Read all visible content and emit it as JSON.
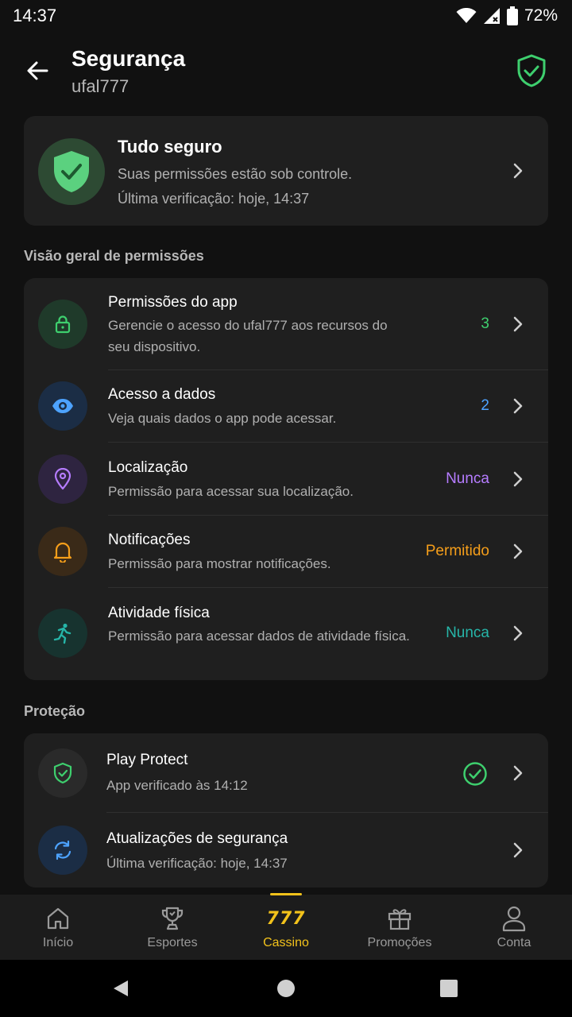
{
  "status_bar": {
    "time": "14:37",
    "battery": "72%"
  },
  "header": {
    "title": "Segurança",
    "subtitle": "ufal777"
  },
  "hero": {
    "title": "Tudo seguro",
    "line1": "Suas permissões estão sob controle.",
    "line2": "Última verificação: hoje, 14:37"
  },
  "permissions_section": {
    "label": "Visão geral de permissões",
    "items": [
      {
        "title": "Permissões do app",
        "desc": "Gerencie o acesso do ufal777 aos recursos do seu dispositivo.",
        "value": "3",
        "value_color": "#3ecf6e",
        "icon": "lock-icon"
      },
      {
        "title": "Acesso a dados",
        "desc": "Veja quais dados o app pode acessar.",
        "value": "2",
        "value_color": "#4da3ff",
        "icon": "eye-icon"
      },
      {
        "title": "Localização",
        "desc": "Permissão para acessar sua localização.",
        "value": "Nunca",
        "value_color": "#b57cff",
        "icon": "location-pin-icon"
      },
      {
        "title": "Notificações",
        "desc": "Permissão para mostrar notificações.",
        "value": "Permitido",
        "value_color": "#f59e1a",
        "icon": "bell-icon"
      },
      {
        "title": "Atividade física",
        "desc": "Permissão para acessar dados de atividade física.",
        "value": "Nunca",
        "value_color": "#26b5a8",
        "icon": "running-person-icon"
      }
    ]
  },
  "protection_section": {
    "label": "Proteção",
    "items": [
      {
        "title": "Play Protect",
        "desc": "App verificado às 14:12",
        "icon": "shield-check-icon",
        "status_icon": "check-circle-icon"
      },
      {
        "title": "Atualizações de segurança",
        "desc": "Última verificação: hoje, 14:37",
        "icon": "sync-icon"
      }
    ]
  },
  "bottom_nav": {
    "items": [
      {
        "label": "Início",
        "icon": "home-icon"
      },
      {
        "label": "Esportes",
        "icon": "trophy-icon"
      },
      {
        "label": "Cassino",
        "icon": "777-logo",
        "logo_text": "777",
        "active": true
      },
      {
        "label": "Promoções",
        "icon": "gift-icon"
      },
      {
        "label": "Conta",
        "icon": "user-icon"
      }
    ]
  },
  "colors": {
    "accent_green": "#3ecf6e",
    "active_tab": "#f2c21b",
    "background": "#111111",
    "card": "#1f1f1f"
  }
}
